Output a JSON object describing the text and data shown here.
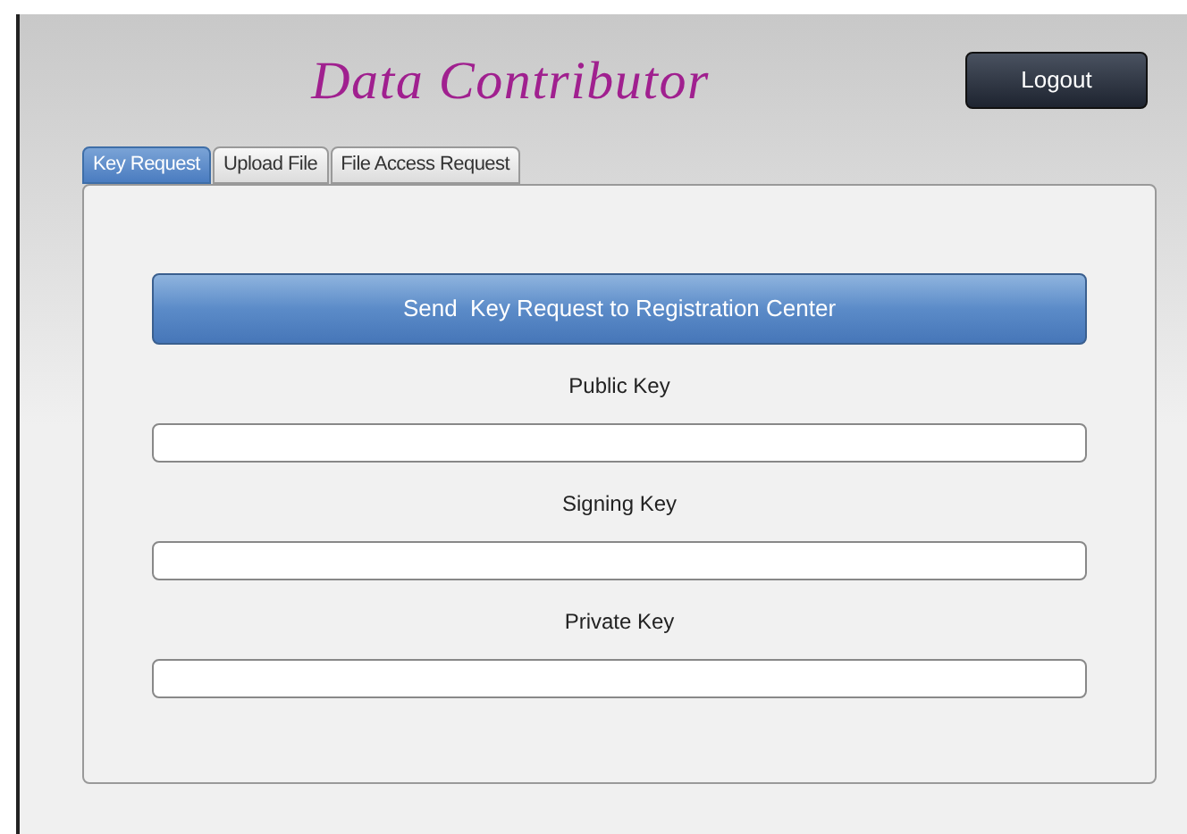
{
  "header": {
    "title": "Data Contributor",
    "logout": "Logout"
  },
  "tabs": [
    {
      "label": "Key Request",
      "selected": true
    },
    {
      "label": "Upload File",
      "selected": false
    },
    {
      "label": "File Access Request",
      "selected": false
    }
  ],
  "action": {
    "label": "Send  Key Request to Registration Center"
  },
  "fields": [
    {
      "label": "Public Key"
    },
    {
      "label": "Signing Key"
    },
    {
      "label": "Private Key"
    }
  ]
}
